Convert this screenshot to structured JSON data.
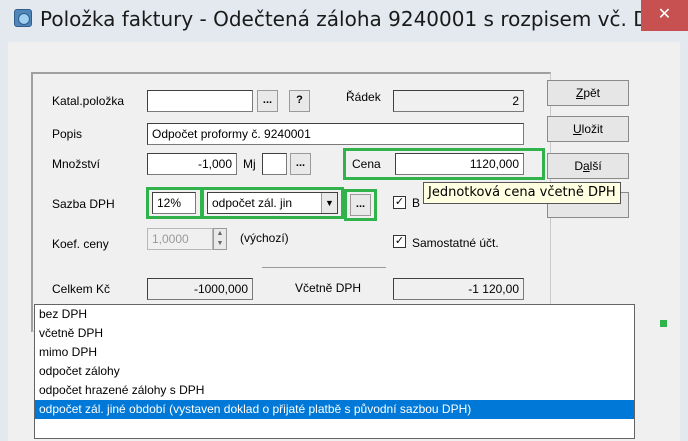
{
  "window": {
    "title": "Položka faktury - Odečtená záloha 9240001 s rozpisem vč. D...",
    "close_glyph": "✕"
  },
  "form": {
    "katal_label": "Katal.položka",
    "katal_value": "",
    "ellipsis": "...",
    "help": "?",
    "radek_label": "Řádek",
    "radek_value": "2",
    "popis_label": "Popis",
    "popis_value": "Odpočet proformy č. 9240001",
    "mnozstvi_label": "Množství",
    "mnozstvi_value": "-1,000",
    "mj_label": "Mj",
    "mj_value": "",
    "cena_label": "Cena",
    "cena_value": "1120,000",
    "sazba_label": "Sazba DPH",
    "sazba_value": "12%",
    "dph_type_value": "odpočet zál. jin",
    "checkbox_b_label": "B",
    "koef_label": "Koef. ceny",
    "koef_value": "1,0000",
    "koef_note": "(výchozí)",
    "samostatne_label": "Samostatné účt.",
    "celkem_label": "Celkem Kč",
    "celkem_value": "-1000,000",
    "vcetne_label": "Včetně DPH",
    "vcetne_value": "-1 120,00"
  },
  "buttons": {
    "zpet_pre": "",
    "zpet_ul": "Z",
    "zpet_post": "pět",
    "ulozit_pre": "",
    "ulozit_ul": "U",
    "ulozit_post": "ložit",
    "dalsi_pre": "D",
    "dalsi_ul": "a",
    "dalsi_post": "lší"
  },
  "tooltip": "Jednotková cena včetně DPH",
  "dropdown": {
    "options": [
      "bez DPH",
      "včetně DPH",
      "mimo DPH",
      "odpočet zálohy",
      "odpočet hrazené zálohy s DPH",
      "odpočet zál. jiné období (vystaven doklad o přijaté platbě s původní sazbou DPH)"
    ],
    "selected_index": 5
  },
  "colors": {
    "highlight": "#2fb34a",
    "selection": "#0078d7",
    "tooltip_bg": "#ffffe1"
  },
  "icons": {
    "app": "invoice-app-icon",
    "close": "close-icon",
    "dropdown": "chevron-down-icon",
    "checkbox": "checkmark-icon"
  }
}
